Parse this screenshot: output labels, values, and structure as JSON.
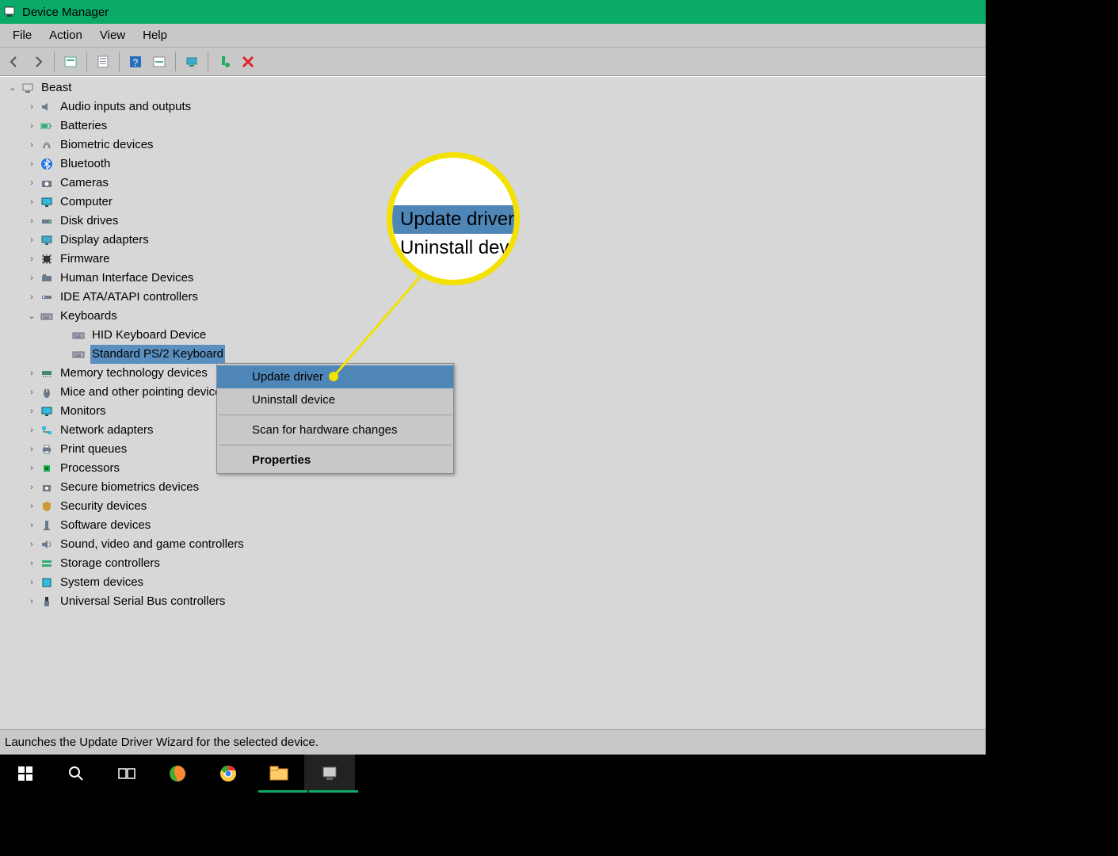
{
  "title_bar": {
    "title": "Device Manager"
  },
  "menu": {
    "file": "File",
    "action": "Action",
    "view": "View",
    "help": "Help"
  },
  "toolbar_icons": [
    "back-icon",
    "forward-icon",
    "show-hidden-icon",
    "properties-icon",
    "help-icon",
    "scan-icon",
    "monitor-icon",
    "add-legacy-icon",
    "delete-icon"
  ],
  "tree": {
    "root": "Beast",
    "categories": [
      {
        "label": "Audio inputs and outputs",
        "icon": "speaker-icon"
      },
      {
        "label": "Batteries",
        "icon": "battery-icon"
      },
      {
        "label": "Biometric devices",
        "icon": "fingerprint-icon"
      },
      {
        "label": "Bluetooth",
        "icon": "bluetooth-icon"
      },
      {
        "label": "Cameras",
        "icon": "camera-icon"
      },
      {
        "label": "Computer",
        "icon": "monitor-icon"
      },
      {
        "label": "Disk drives",
        "icon": "disk-icon"
      },
      {
        "label": "Display adapters",
        "icon": "display-icon"
      },
      {
        "label": "Firmware",
        "icon": "chip-icon"
      },
      {
        "label": "Human Interface Devices",
        "icon": "hid-icon"
      },
      {
        "label": "IDE ATA/ATAPI controllers",
        "icon": "ide-icon"
      },
      {
        "label": "Keyboards",
        "icon": "keyboard-icon",
        "expanded": true,
        "children": [
          {
            "label": "HID Keyboard Device",
            "icon": "keyboard-icon"
          },
          {
            "label": "Standard PS/2 Keyboard",
            "icon": "keyboard-icon",
            "selected": true
          }
        ]
      },
      {
        "label": "Memory technology devices",
        "icon": "memory-icon"
      },
      {
        "label": "Mice and other pointing devices",
        "icon": "mouse-icon"
      },
      {
        "label": "Monitors",
        "icon": "monitor-icon"
      },
      {
        "label": "Network adapters",
        "icon": "network-icon"
      },
      {
        "label": "Print queues",
        "icon": "printer-icon"
      },
      {
        "label": "Processors",
        "icon": "cpu-icon"
      },
      {
        "label": "Secure biometrics devices",
        "icon": "secure-bio-icon"
      },
      {
        "label": "Security devices",
        "icon": "security-icon"
      },
      {
        "label": "Software devices",
        "icon": "software-icon"
      },
      {
        "label": "Sound, video and game controllers",
        "icon": "sound-icon"
      },
      {
        "label": "Storage controllers",
        "icon": "storage-icon"
      },
      {
        "label": "System devices",
        "icon": "system-icon"
      },
      {
        "label": "Universal Serial Bus controllers",
        "icon": "usb-icon"
      }
    ]
  },
  "context_menu": {
    "update": "Update driver",
    "uninstall": "Uninstall device",
    "scan": "Scan for hardware changes",
    "properties": "Properties"
  },
  "magnifier": {
    "line1": "Update driver",
    "line2": "Uninstall dev"
  },
  "status_bar": "Launches the Update Driver Wizard for the selected device.",
  "taskbar": {
    "items": [
      "start",
      "search",
      "task-view",
      "firefox",
      "chrome",
      "file-explorer",
      "device-manager"
    ]
  }
}
